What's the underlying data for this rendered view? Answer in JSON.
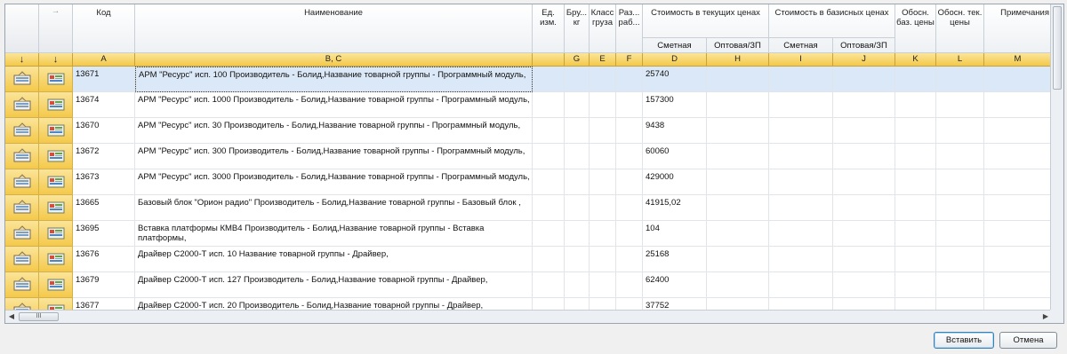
{
  "columns": {
    "kod": "Код",
    "name": "Наименование",
    "unit": "Ед. изм.",
    "brutto": "Бру... кг",
    "klass": "Класс груза",
    "razrab": "Раз... раб...",
    "cur_group": "Стоимость в текущих ценах",
    "cur_smetn": "Сметная",
    "cur_opt": "Оптовая/ЗП",
    "base_group": "Стоимость в базисных ценах",
    "base_smetn": "Сметная",
    "base_opt": "Оптовая/ЗП",
    "obos_base": "Обосн. баз. цены",
    "obos_tek": "Обосн. тек. цены",
    "prim": "Примечания"
  },
  "arrows": {
    "col1": "↓",
    "col2": "↓",
    "col2_top": "→"
  },
  "letters": {
    "col1": "↓",
    "col2": "↓",
    "kod": "A",
    "name": "B, C",
    "unit": "",
    "brutto": "G",
    "klass": "E",
    "razrab": "F",
    "cur_smetn": "D",
    "cur_opt": "H",
    "base_smetn": "I",
    "base_opt": "J",
    "obos_base": "K",
    "obos_tek": "L",
    "prim": "M"
  },
  "rows": [
    {
      "kod": "13671",
      "name": "АРМ \"Ресурс\" исп. 100 Производитель - Болид,Название товарной группы - Программный модуль,",
      "price": "25740"
    },
    {
      "kod": "13674",
      "name": "АРМ \"Ресурс\" исп. 1000 Производитель - Болид,Название товарной группы - Программный модуль,",
      "price": "157300"
    },
    {
      "kod": "13670",
      "name": "АРМ \"Ресурс\" исп. 30 Производитель - Болид,Название товарной группы - Программный модуль,",
      "price": "9438"
    },
    {
      "kod": "13672",
      "name": "АРМ \"Ресурс\" исп. 300 Производитель - Болид,Название товарной группы - Программный модуль,",
      "price": "60060"
    },
    {
      "kod": "13673",
      "name": "АРМ \"Ресурс\" исп. 3000 Производитель - Болид,Название товарной группы - Программный модуль,",
      "price": "429000"
    },
    {
      "kod": "13665",
      "name": "Базовый блок \"Орион радио\" Производитель - Болид,Название товарной группы - Базовый блок ,",
      "price": "41915,02"
    },
    {
      "kod": "13695",
      "name": "Вставка платформы КМВ4 Производитель - Болид,Название товарной группы - Вставка платформы,",
      "price": "104"
    },
    {
      "kod": "13676",
      "name": "Драйвер С2000-Т исп. 10 Название товарной группы - Драйвер,",
      "price": "25168"
    },
    {
      "kod": "13679",
      "name": "Драйвер С2000-Т исп. 127 Производитель - Болид,Название товарной группы - Драйвер,",
      "price": "62400"
    },
    {
      "kod": "13677",
      "name": "Драйвер С2000-Т исп. 20 Производитель - Болид,Название товарной группы - Драйвер,",
      "price": "37752"
    }
  ],
  "scrollbar": {
    "h_thumb": "III"
  },
  "buttons": {
    "insert": "Вставить",
    "cancel": "Отмена"
  }
}
